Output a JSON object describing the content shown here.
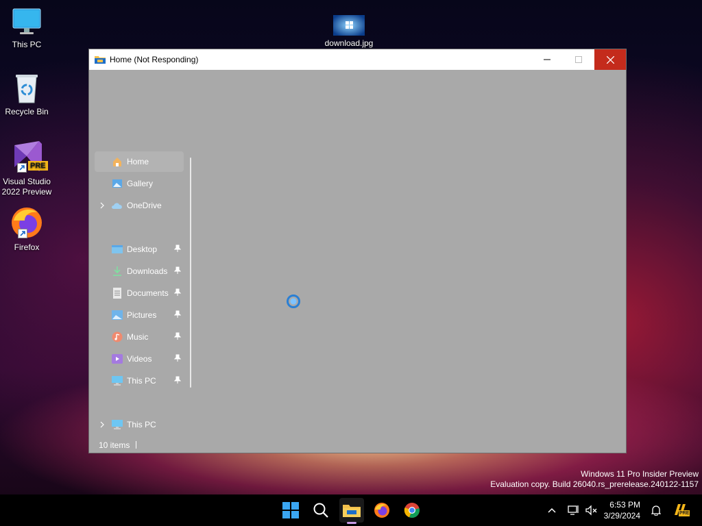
{
  "desktop": {
    "icons": [
      {
        "label": "This PC"
      },
      {
        "label": "Recycle Bin"
      },
      {
        "label": "Visual Studio 2022 Preview",
        "badge": "PRE"
      },
      {
        "label": "Firefox"
      },
      {
        "label": "download.jpg"
      }
    ]
  },
  "window": {
    "title": "Home (Not Responding)",
    "nav": [
      {
        "label": "Home",
        "icon": "home-icon",
        "active": true
      },
      {
        "label": "Gallery",
        "icon": "gallery-icon"
      },
      {
        "label": "OneDrive",
        "icon": "cloud-icon",
        "expandable": true
      },
      {
        "label": "Desktop",
        "icon": "desktop-folder-icon",
        "pinned": true
      },
      {
        "label": "Downloads",
        "icon": "download-icon",
        "pinned": true
      },
      {
        "label": "Documents",
        "icon": "document-icon",
        "pinned": true
      },
      {
        "label": "Pictures",
        "icon": "picture-icon",
        "pinned": true
      },
      {
        "label": "Music",
        "icon": "music-icon",
        "pinned": true
      },
      {
        "label": "Videos",
        "icon": "video-icon",
        "pinned": true
      },
      {
        "label": "This PC",
        "icon": "computer-icon",
        "pinned": true
      },
      {
        "label": "This PC",
        "icon": "computer-icon",
        "expandable": true
      }
    ],
    "status": "10 items"
  },
  "watermark": {
    "line1": "Windows 11 Pro Insider Preview",
    "line2": "Evaluation copy. Build 26040.rs_prerelease.240122-1157"
  },
  "taskbar": {
    "apps": [
      "start-icon",
      "search-icon",
      "file-explorer-icon",
      "firefox-icon",
      "chrome-icon"
    ],
    "time": "6:53 PM",
    "date": "3/29/2024",
    "tray_badge": "PRE"
  },
  "colors": {
    "close_button": "#c42b1c",
    "window_body": "#a9a9a9",
    "taskbar": "#000000"
  }
}
